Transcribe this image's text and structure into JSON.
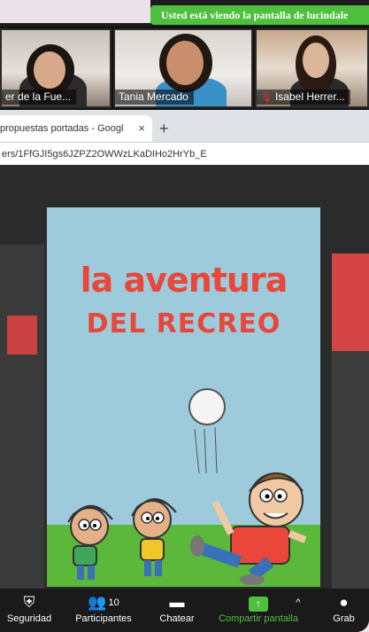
{
  "banner": {
    "text": "Usted está viendo la pantalla de lucindale"
  },
  "participants": [
    {
      "name": "er de la Fue...",
      "muted": false
    },
    {
      "name": "Tania Mercado",
      "muted": false
    },
    {
      "name": "Isabel Herrer...",
      "muted": true
    }
  ],
  "browser": {
    "tab_title": "propuestas portadas - Googl",
    "tab_close": "×",
    "new_tab": "+",
    "address": "ers/1FfGJI5gs6JZPZ2OWWzLKaDIHo2HrYb_E"
  },
  "slide": {
    "title_line1": "la aventura",
    "title_line2": "DEL RECREO"
  },
  "toolbar": {
    "items": [
      {
        "label": "Seguridad",
        "icon": "shield-icon"
      },
      {
        "label": "Participantes",
        "icon": "participants-icon",
        "count": "10"
      },
      {
        "label": "Chatear",
        "icon": "chat-icon"
      },
      {
        "label": "Compartir pantalla",
        "icon": "share-screen-icon"
      },
      {
        "label": "Grab",
        "icon": "record-icon"
      }
    ],
    "share_arrow": "^"
  },
  "colors": {
    "accent_green": "#4fbf3e",
    "title_red": "#e9473a",
    "slide_bg": "#9dcbdc"
  }
}
